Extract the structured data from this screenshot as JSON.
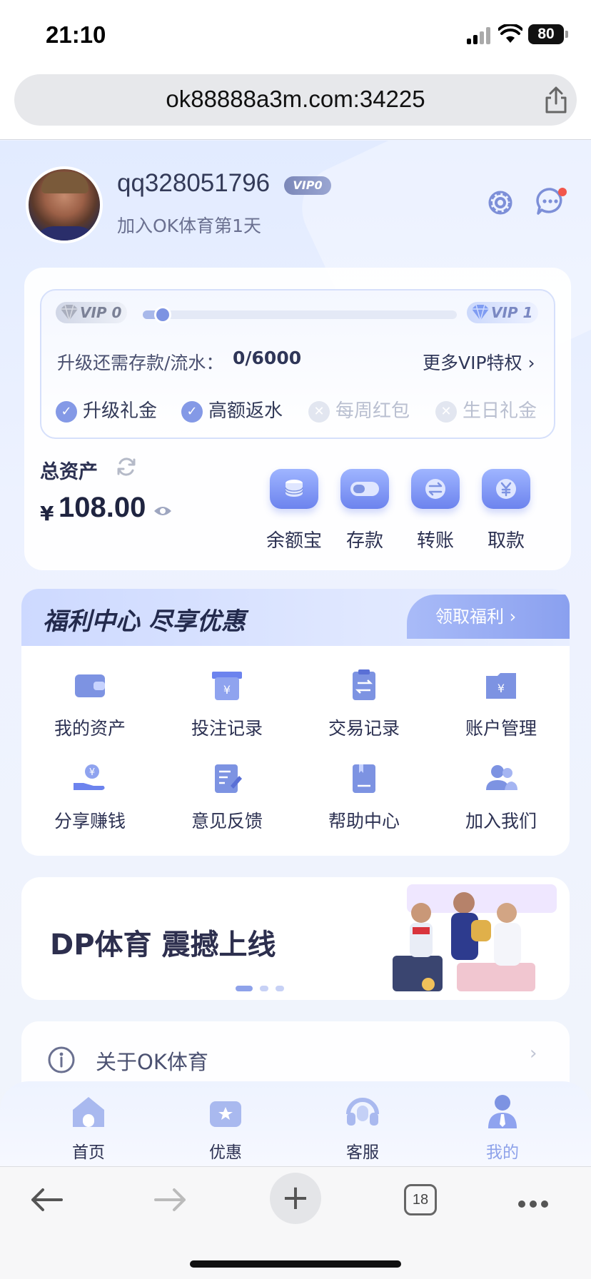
{
  "status": {
    "time": "21:10",
    "battery": "80"
  },
  "browser": {
    "url": "ok88888a3m.com:34225",
    "tab_count": "18"
  },
  "profile": {
    "username": "qq328051796",
    "vip_badge": "VIP0",
    "joined": "加入OK体育第1天"
  },
  "vip": {
    "current": "VIP 0",
    "next": "VIP 1",
    "progress": 0.06,
    "upgrade_label": "升级还需存款/流水：",
    "upgrade_value": "0/6000",
    "more_label": "更多VIP特权",
    "perks": [
      {
        "label": "升级礼金",
        "enabled": true
      },
      {
        "label": "高额返水",
        "enabled": true
      },
      {
        "label": "每周红包",
        "enabled": false
      },
      {
        "label": "生日礼金",
        "enabled": false
      }
    ]
  },
  "assets": {
    "title": "总资产",
    "currency": "¥",
    "balance": "108.00",
    "actions": [
      {
        "label": "余额宝",
        "icon": "coins-icon"
      },
      {
        "label": "存款",
        "icon": "wallet-icon"
      },
      {
        "label": "转账",
        "icon": "transfer-icon"
      },
      {
        "label": "取款",
        "icon": "withdraw-icon"
      }
    ]
  },
  "welfare": {
    "title": "福利中心 尽享优惠",
    "claim": "领取福利",
    "items": [
      {
        "label": "我的资产",
        "icon": "wallet-icon"
      },
      {
        "label": "投注记录",
        "icon": "bet-record-icon"
      },
      {
        "label": "交易记录",
        "icon": "transaction-icon"
      },
      {
        "label": "账户管理",
        "icon": "account-folder-icon"
      },
      {
        "label": "分享赚钱",
        "icon": "share-money-icon"
      },
      {
        "label": "意见反馈",
        "icon": "feedback-icon"
      },
      {
        "label": "帮助中心",
        "icon": "help-book-icon"
      },
      {
        "label": "加入我们",
        "icon": "users-icon"
      }
    ]
  },
  "banner": {
    "text": "DP体育 震撼上线",
    "slides": 3,
    "active": 0
  },
  "about": {
    "label": "关于OK体育"
  },
  "tabs": [
    {
      "label": "首页",
      "icon": "home-icon",
      "active": false
    },
    {
      "label": "优惠",
      "icon": "promo-icon",
      "active": false
    },
    {
      "label": "客服",
      "icon": "headset-icon",
      "active": false
    },
    {
      "label": "我的",
      "icon": "profile-icon",
      "active": true
    }
  ],
  "colors": {
    "accent": "#8499e6",
    "accent_dark": "#6c83ee",
    "text": "#2c3152"
  }
}
